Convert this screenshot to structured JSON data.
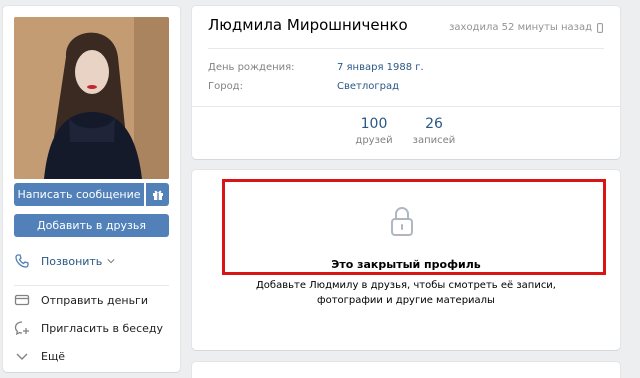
{
  "profile": {
    "name": "Людмила Мирошниченко",
    "last_seen": "заходила 52 минуты назад",
    "birthday_label": "День рождения:",
    "birthday_value": "7 января 1988 г.",
    "city_label": "Город:",
    "city_value": "Светлоград",
    "stats": [
      {
        "num": "100",
        "label": "друзей"
      },
      {
        "num": "26",
        "label": "записей"
      }
    ]
  },
  "actions": {
    "send_message": "Написать сообщение",
    "add_friend": "Добавить в друзья",
    "call": "Позвонить",
    "send_money": "Отправить деньги",
    "invite_chat": "Пригласить в беседу",
    "more": "Ещё"
  },
  "private": {
    "title": "Это закрытый профиль",
    "description": "Добавьте Людмилу в друзья, чтобы смотреть её записи, фотографии и другие материалы"
  },
  "colors": {
    "accent": "#5181b8",
    "link": "#2a5885",
    "highlight_border": "#d81414"
  }
}
